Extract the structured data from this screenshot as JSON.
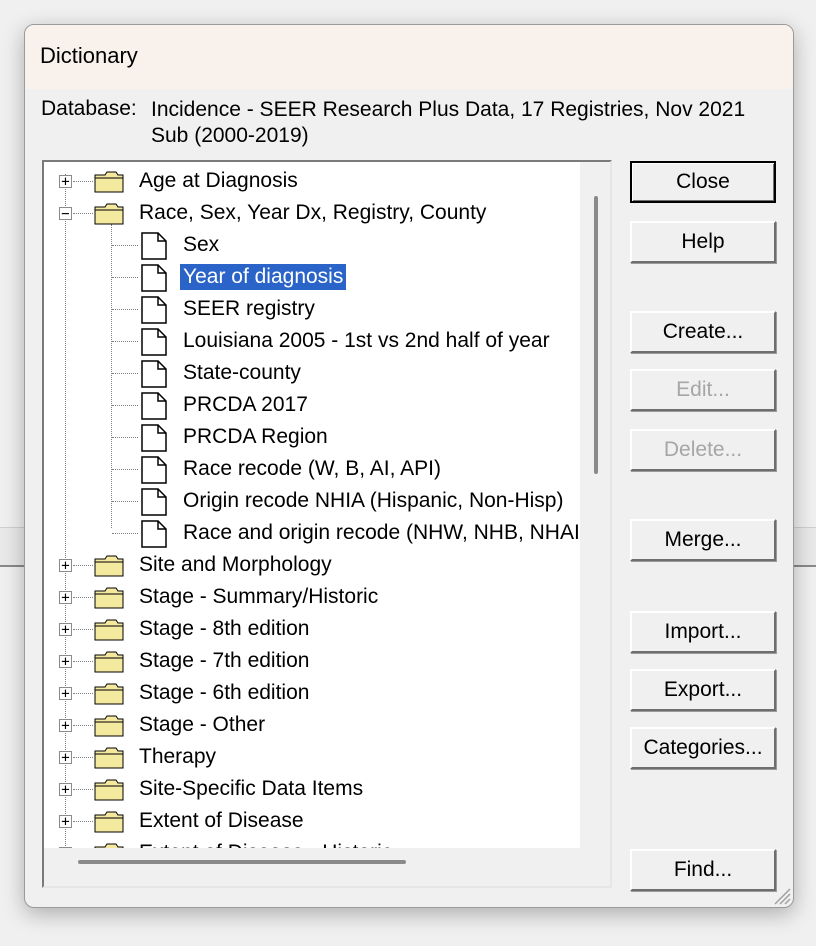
{
  "window": {
    "title": "Dictionary"
  },
  "database": {
    "label": "Database:",
    "value": "Incidence - SEER Research Plus Data, 17 Registries, Nov 2021 Sub (2000-2019)"
  },
  "tree": {
    "folders_top": [
      {
        "label": "Age at Diagnosis",
        "expander": "+"
      },
      {
        "label": "Race, Sex, Year Dx, Registry, County",
        "expander": "−"
      }
    ],
    "children": [
      {
        "label": "Sex",
        "selected": false
      },
      {
        "label": "Year of diagnosis",
        "selected": true
      },
      {
        "label": "SEER registry",
        "selected": false
      },
      {
        "label": "Louisiana 2005 - 1st vs 2nd half of year",
        "selected": false
      },
      {
        "label": "State-county",
        "selected": false
      },
      {
        "label": "PRCDA 2017",
        "selected": false
      },
      {
        "label": "PRCDA Region",
        "selected": false
      },
      {
        "label": "Race recode (W, B, AI, API)",
        "selected": false
      },
      {
        "label": "Origin recode NHIA (Hispanic, Non-Hisp)",
        "selected": false
      },
      {
        "label": "Race and origin recode (NHW, NHB, NHAIAN, NHAPI, Hispanic)",
        "selected": false
      }
    ],
    "folders_bottom": [
      {
        "label": "Site and Morphology",
        "expander": "+"
      },
      {
        "label": "Stage - Summary/Historic",
        "expander": "+"
      },
      {
        "label": "Stage - 8th edition",
        "expander": "+"
      },
      {
        "label": "Stage - 7th edition",
        "expander": "+"
      },
      {
        "label": "Stage - 6th edition",
        "expander": "+"
      },
      {
        "label": "Stage - Other",
        "expander": "+"
      },
      {
        "label": "Therapy",
        "expander": "+"
      },
      {
        "label": "Site-Specific Data Items",
        "expander": "+"
      },
      {
        "label": "Extent of Disease",
        "expander": "+"
      },
      {
        "label": "Extent of Disease - Historic",
        "expander": "+"
      }
    ]
  },
  "buttons": {
    "close": "Close",
    "help": "Help",
    "create": "Create...",
    "edit": "Edit...",
    "delete": "Delete...",
    "merge": "Merge...",
    "import": "Import...",
    "export": "Export...",
    "categories": "Categories...",
    "find": "Find..."
  },
  "colors": {
    "selection": "#2a64c8",
    "folder_fill": "#f3eaa0",
    "disabled_text": "#a6a6a6"
  },
  "icons": {
    "folder": "folder-icon",
    "document": "document-icon",
    "expand": "plus-box-icon",
    "collapse": "minus-box-icon"
  }
}
